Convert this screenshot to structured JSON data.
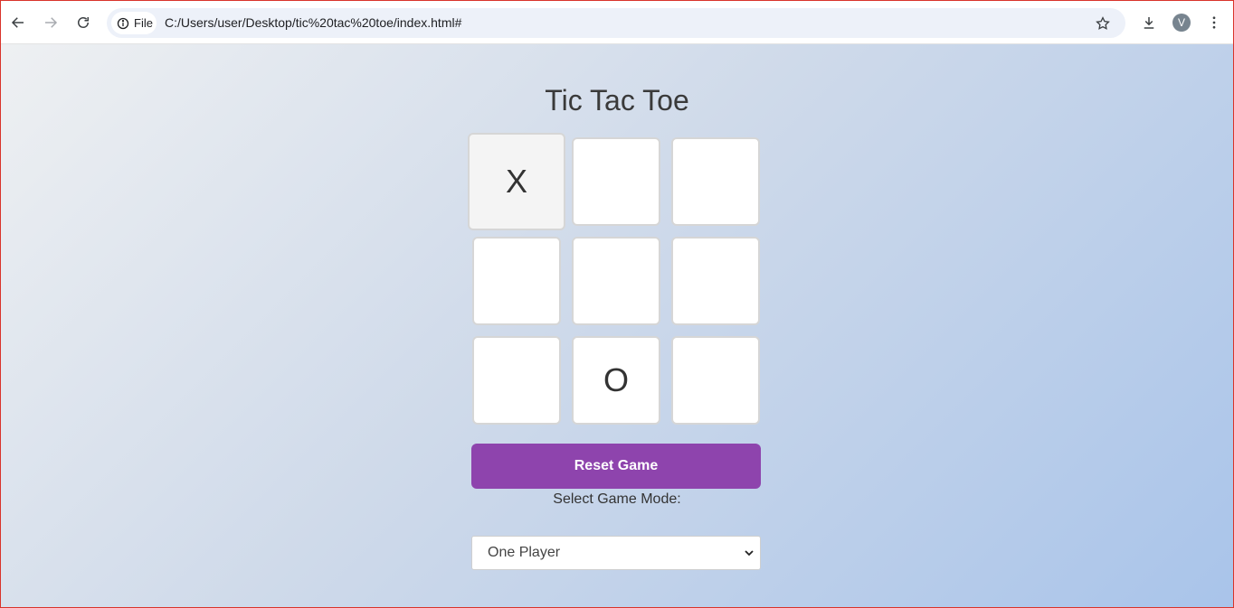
{
  "browser": {
    "chip_label": "File",
    "url": "C:/Users/user/Desktop/tic%20tac%20toe/index.html#",
    "avatar_letter": "V"
  },
  "game": {
    "title": "Tic Tac Toe",
    "cells": [
      "X",
      "",
      "",
      "",
      "",
      "",
      "",
      "O",
      ""
    ],
    "reset_label": "Reset Game",
    "mode_label": "Select Game Mode:",
    "mode_selected": "One Player"
  },
  "colors": {
    "accent": "#8e44ad",
    "frame": "#d9342b"
  },
  "icons": [
    "back-icon",
    "forward-icon",
    "reload-icon",
    "info-icon",
    "star-icon",
    "download-icon",
    "more-icon"
  ]
}
